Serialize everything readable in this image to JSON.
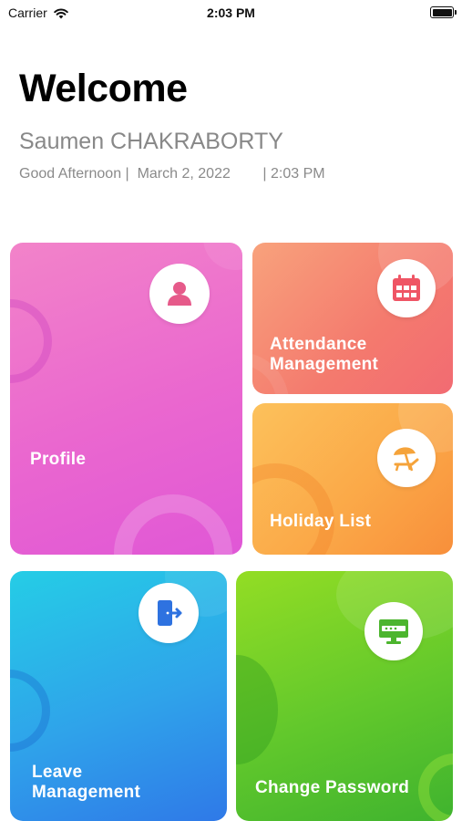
{
  "status_bar": {
    "carrier": "Carrier",
    "time": "2:03 PM",
    "wifi_icon": "wifi-icon",
    "battery_icon": "battery-icon"
  },
  "header": {
    "title": "Welcome",
    "user_name": "Saumen CHAKRABORTY",
    "greeting_line": "Good Afternoon |  March 2, 2022        | 2:03 PM"
  },
  "tiles": {
    "profile": {
      "label": "Profile",
      "icon": "person-icon",
      "color": "#ea67cf"
    },
    "attendance": {
      "label_line1": "Attendance",
      "label_line2": "Management",
      "icon": "calendar-icon",
      "color": "#f47a6e"
    },
    "holiday": {
      "label": "Holiday List",
      "icon": "beach-umbrella-icon",
      "color": "#fba948"
    },
    "leave": {
      "label_line1": "Leave",
      "label_line2": "Management",
      "icon": "exit-door-icon",
      "color": "#2fa3ea"
    },
    "password": {
      "label": "Change Password",
      "icon": "password-screen-icon",
      "color": "#62c82c"
    }
  }
}
